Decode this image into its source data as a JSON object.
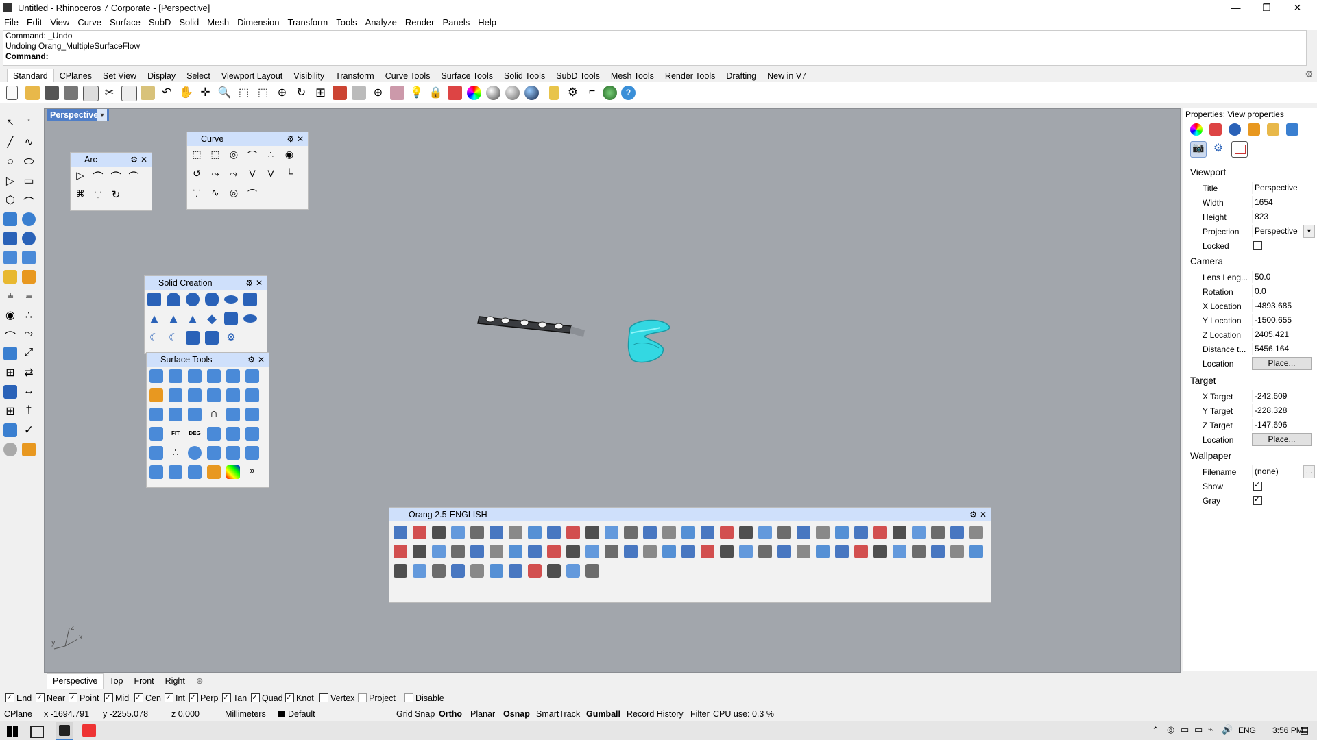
{
  "window": {
    "title": "Untitled - Rhinoceros 7 Corporate - [Perspective]",
    "min_icon": "minimize-icon",
    "max_icon": "restore-icon",
    "close_icon": "close-icon"
  },
  "menu": [
    "File",
    "Edit",
    "View",
    "Curve",
    "Surface",
    "SubD",
    "Solid",
    "Mesh",
    "Dimension",
    "Transform",
    "Tools",
    "Analyze",
    "Render",
    "Panels",
    "Help"
  ],
  "command": {
    "history": [
      "Command: _Undo",
      "Undoing Orang_MultipleSurfaceFlow"
    ],
    "prompt": "Command:"
  },
  "toolbar_tabs": [
    "Standard",
    "CPlanes",
    "Set View",
    "Display",
    "Select",
    "Viewport Layout",
    "Visibility",
    "Transform",
    "Curve Tools",
    "Surface Tools",
    "Solid Tools",
    "SubD Tools",
    "Mesh Tools",
    "Render Tools",
    "Drafting",
    "New in V7"
  ],
  "active_toolbar_tab": "Standard",
  "viewport": {
    "title": "Perspective",
    "axis_labels": [
      "z",
      "y",
      "x"
    ]
  },
  "panels": {
    "arc": {
      "title": "Arc"
    },
    "curve": {
      "title": "Curve"
    },
    "solid_creation": {
      "title": "Solid Creation"
    },
    "surface_tools": {
      "title": "Surface Tools",
      "more": "»"
    },
    "orang": {
      "title": "Orang  2.5-ENGLISH"
    }
  },
  "viewport_tabs": [
    "Perspective",
    "Top",
    "Front",
    "Right"
  ],
  "osnap": [
    {
      "label": "End",
      "checked": true
    },
    {
      "label": "Near",
      "checked": true
    },
    {
      "label": "Point",
      "checked": true
    },
    {
      "label": "Mid",
      "checked": true
    },
    {
      "label": "Cen",
      "checked": true
    },
    {
      "label": "Int",
      "checked": true
    },
    {
      "label": "Perp",
      "checked": true
    },
    {
      "label": "Tan",
      "checked": true
    },
    {
      "label": "Quad",
      "checked": true
    },
    {
      "label": "Knot",
      "checked": true
    },
    {
      "label": "Vertex",
      "checked": false
    },
    {
      "label": "Project",
      "checked": false
    },
    {
      "label": "Disable",
      "checked": false
    }
  ],
  "status": {
    "cplane": "CPlane",
    "x": "x -1694.791",
    "y": "y -2255.078",
    "z": "z 0.000",
    "units": "Millimeters",
    "layer": "Default",
    "grid_snap": "Grid Snap",
    "ortho": "Ortho",
    "planar": "Planar",
    "osnap": "Osnap",
    "smarttrack": "SmartTrack",
    "gumball": "Gumball",
    "record_history": "Record History",
    "filter": "Filter",
    "cpu": "CPU use: 0.3 %"
  },
  "taskbar": {
    "lang": "ENG",
    "time": "3:56 PM"
  },
  "properties": {
    "header": "Properties: View properties",
    "viewport_section": "Viewport",
    "title_label": "Title",
    "title_value": "Perspective",
    "width_label": "Width",
    "width_value": "1654",
    "height_label": "Height",
    "height_value": "823",
    "projection_label": "Projection",
    "projection_value": "Perspective",
    "locked_label": "Locked",
    "camera_section": "Camera",
    "lens_label": "Lens Leng...",
    "lens_value": "50.0",
    "rotation_label": "Rotation",
    "rotation_value": "0.0",
    "xloc_label": "X Location",
    "xloc_value": "-4893.685",
    "yloc_label": "Y Location",
    "yloc_value": "-1500.655",
    "zloc_label": "Z Location",
    "zloc_value": "2405.421",
    "dist_label": "Distance t...",
    "dist_value": "5456.164",
    "location_label": "Location",
    "place_button": "Place...",
    "target_section": "Target",
    "xt_label": "X Target",
    "xt_value": "-242.609",
    "yt_label": "Y Target",
    "yt_value": "-228.328",
    "zt_label": "Z Target",
    "zt_value": "-147.696",
    "tlocation_label": "Location",
    "tplace_button": "Place...",
    "wallpaper_section": "Wallpaper",
    "filename_label": "Filename",
    "filename_value": "(none)",
    "browse_button": "...",
    "show_label": "Show",
    "gray_label": "Gray"
  }
}
